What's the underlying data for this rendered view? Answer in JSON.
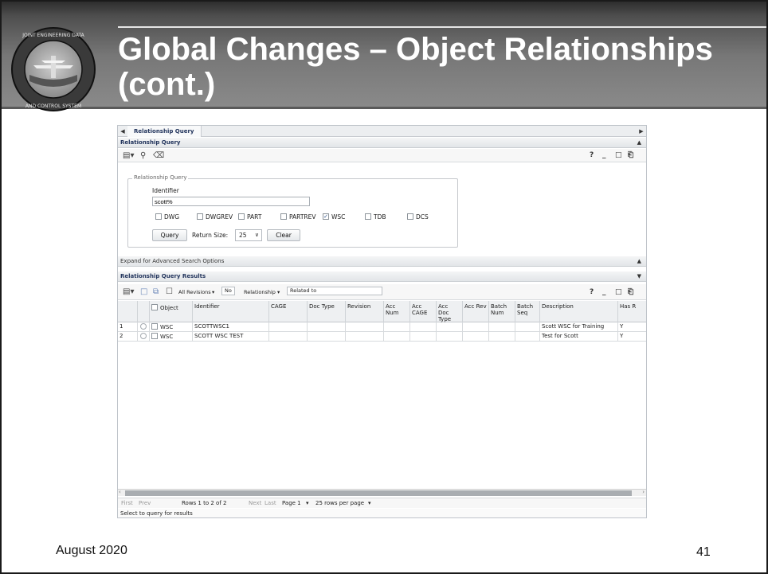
{
  "slide": {
    "title_line1": "Global Changes – Object Relationships",
    "title_line2": "(cont.)",
    "footer_date": "August 2020",
    "page_number": "41",
    "seal_text_top": "JOINT ENGINEERING DATA MANAGEMENT",
    "seal_text_bottom": "INFORMATION AND CONTROL SYSTEM"
  },
  "app": {
    "tab_label": "Relationship Query",
    "query_section": {
      "header": "Relationship Query",
      "fieldset_legend": "Relationship Query",
      "identifier_label": "Identifier",
      "identifier_value": "scott%",
      "object_types": [
        {
          "label": "DWG",
          "checked": false
        },
        {
          "label": "DWGREV",
          "checked": false
        },
        {
          "label": "PART",
          "checked": false
        },
        {
          "label": "PARTREV",
          "checked": false
        },
        {
          "label": "WSC",
          "checked": true
        },
        {
          "label": "TDB",
          "checked": false
        },
        {
          "label": "DCS",
          "checked": false
        }
      ],
      "query_button": "Query",
      "return_size_label": "Return Size:",
      "return_size_value": "25",
      "clear_button": "Clear",
      "toolbar_help": "?",
      "toolbar_min": "_",
      "toolbar_max": "□",
      "toolbar_restore": "⎗"
    },
    "advanced_section": {
      "header": "Expand for Advanced Search Options"
    },
    "results_section": {
      "header": "Relationship Query Results",
      "revisions_filter": "All Revisions",
      "revisions_value": "No",
      "relationship_label": "Relationship",
      "relationship_value": "Related to",
      "columns": [
        "Object",
        "Identifier",
        "CAGE",
        "Doc Type",
        "Revision",
        "Acc Num",
        "Acc CAGE",
        "Acc Doc Type",
        "Acc Rev",
        "Batch Num",
        "Batch Seq",
        "Description",
        "Has R"
      ],
      "rows": [
        {
          "num": "1",
          "object": "WSC",
          "identifier": "SCOTTWSC1",
          "description": "Scott WSC for Training",
          "has_r": "Y"
        },
        {
          "num": "2",
          "object": "WSC",
          "identifier": "SCOTT WSC TEST",
          "description": "Test for Scott",
          "has_r": "Y"
        }
      ],
      "pager": {
        "first": "First",
        "prev": "Prev",
        "rows_info": "Rows 1 to 2 of 2",
        "next": "Next",
        "last": "Last",
        "page": "Page 1",
        "rows_per_page": "25 rows per page"
      },
      "status": "Select to query for results"
    }
  }
}
